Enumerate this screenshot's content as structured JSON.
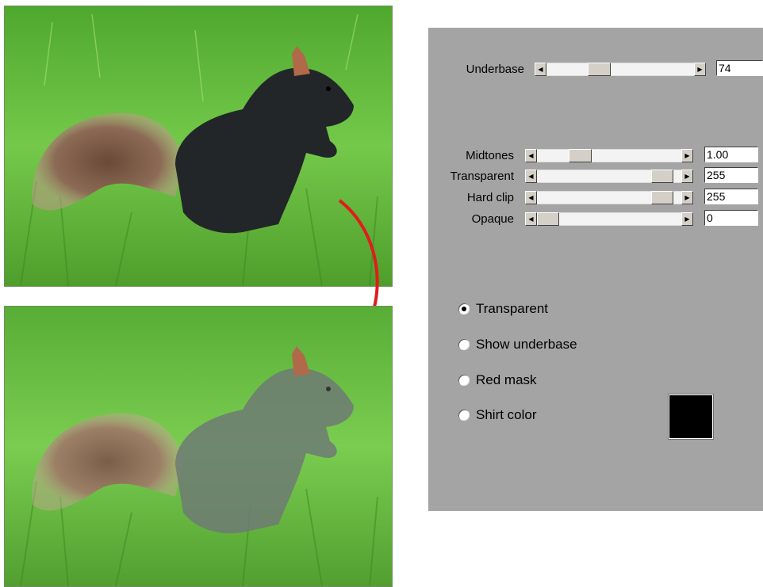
{
  "images": {
    "before": {
      "name": "black-squirrel-original"
    },
    "after": {
      "name": "squirrel-transparent-preview"
    }
  },
  "underbase": {
    "label": "Underbase",
    "value": "74",
    "slider_fraction": 0.37
  },
  "adjustments": [
    {
      "key": "midtones",
      "label": "Midtones",
      "value": "1.00",
      "slider_fraction": 0.2
    },
    {
      "key": "transparent",
      "label": "Transparent",
      "value": "255",
      "slider_fraction": 1.0
    },
    {
      "key": "hard-clip",
      "label": "Hard clip",
      "value": "255",
      "slider_fraction": 1.0
    },
    {
      "key": "opaque",
      "label": "Opaque",
      "value": "0",
      "slider_fraction": 0.0
    }
  ],
  "view_modes": [
    {
      "key": "transparent",
      "label": "Transparent",
      "checked": true
    },
    {
      "key": "show-underbase",
      "label": "Show underbase",
      "checked": false
    },
    {
      "key": "red-mask",
      "label": "Red mask",
      "checked": false
    },
    {
      "key": "shirt-color",
      "label": "Shirt color",
      "checked": false
    }
  ],
  "shirt_color": "#000000",
  "colors": {
    "panel": "#a4a4a4",
    "arrow": "#e01c1c",
    "grass": "#5cb83a"
  },
  "icons": {
    "scroll_left": "left-triangle",
    "scroll_right": "right-triangle"
  }
}
